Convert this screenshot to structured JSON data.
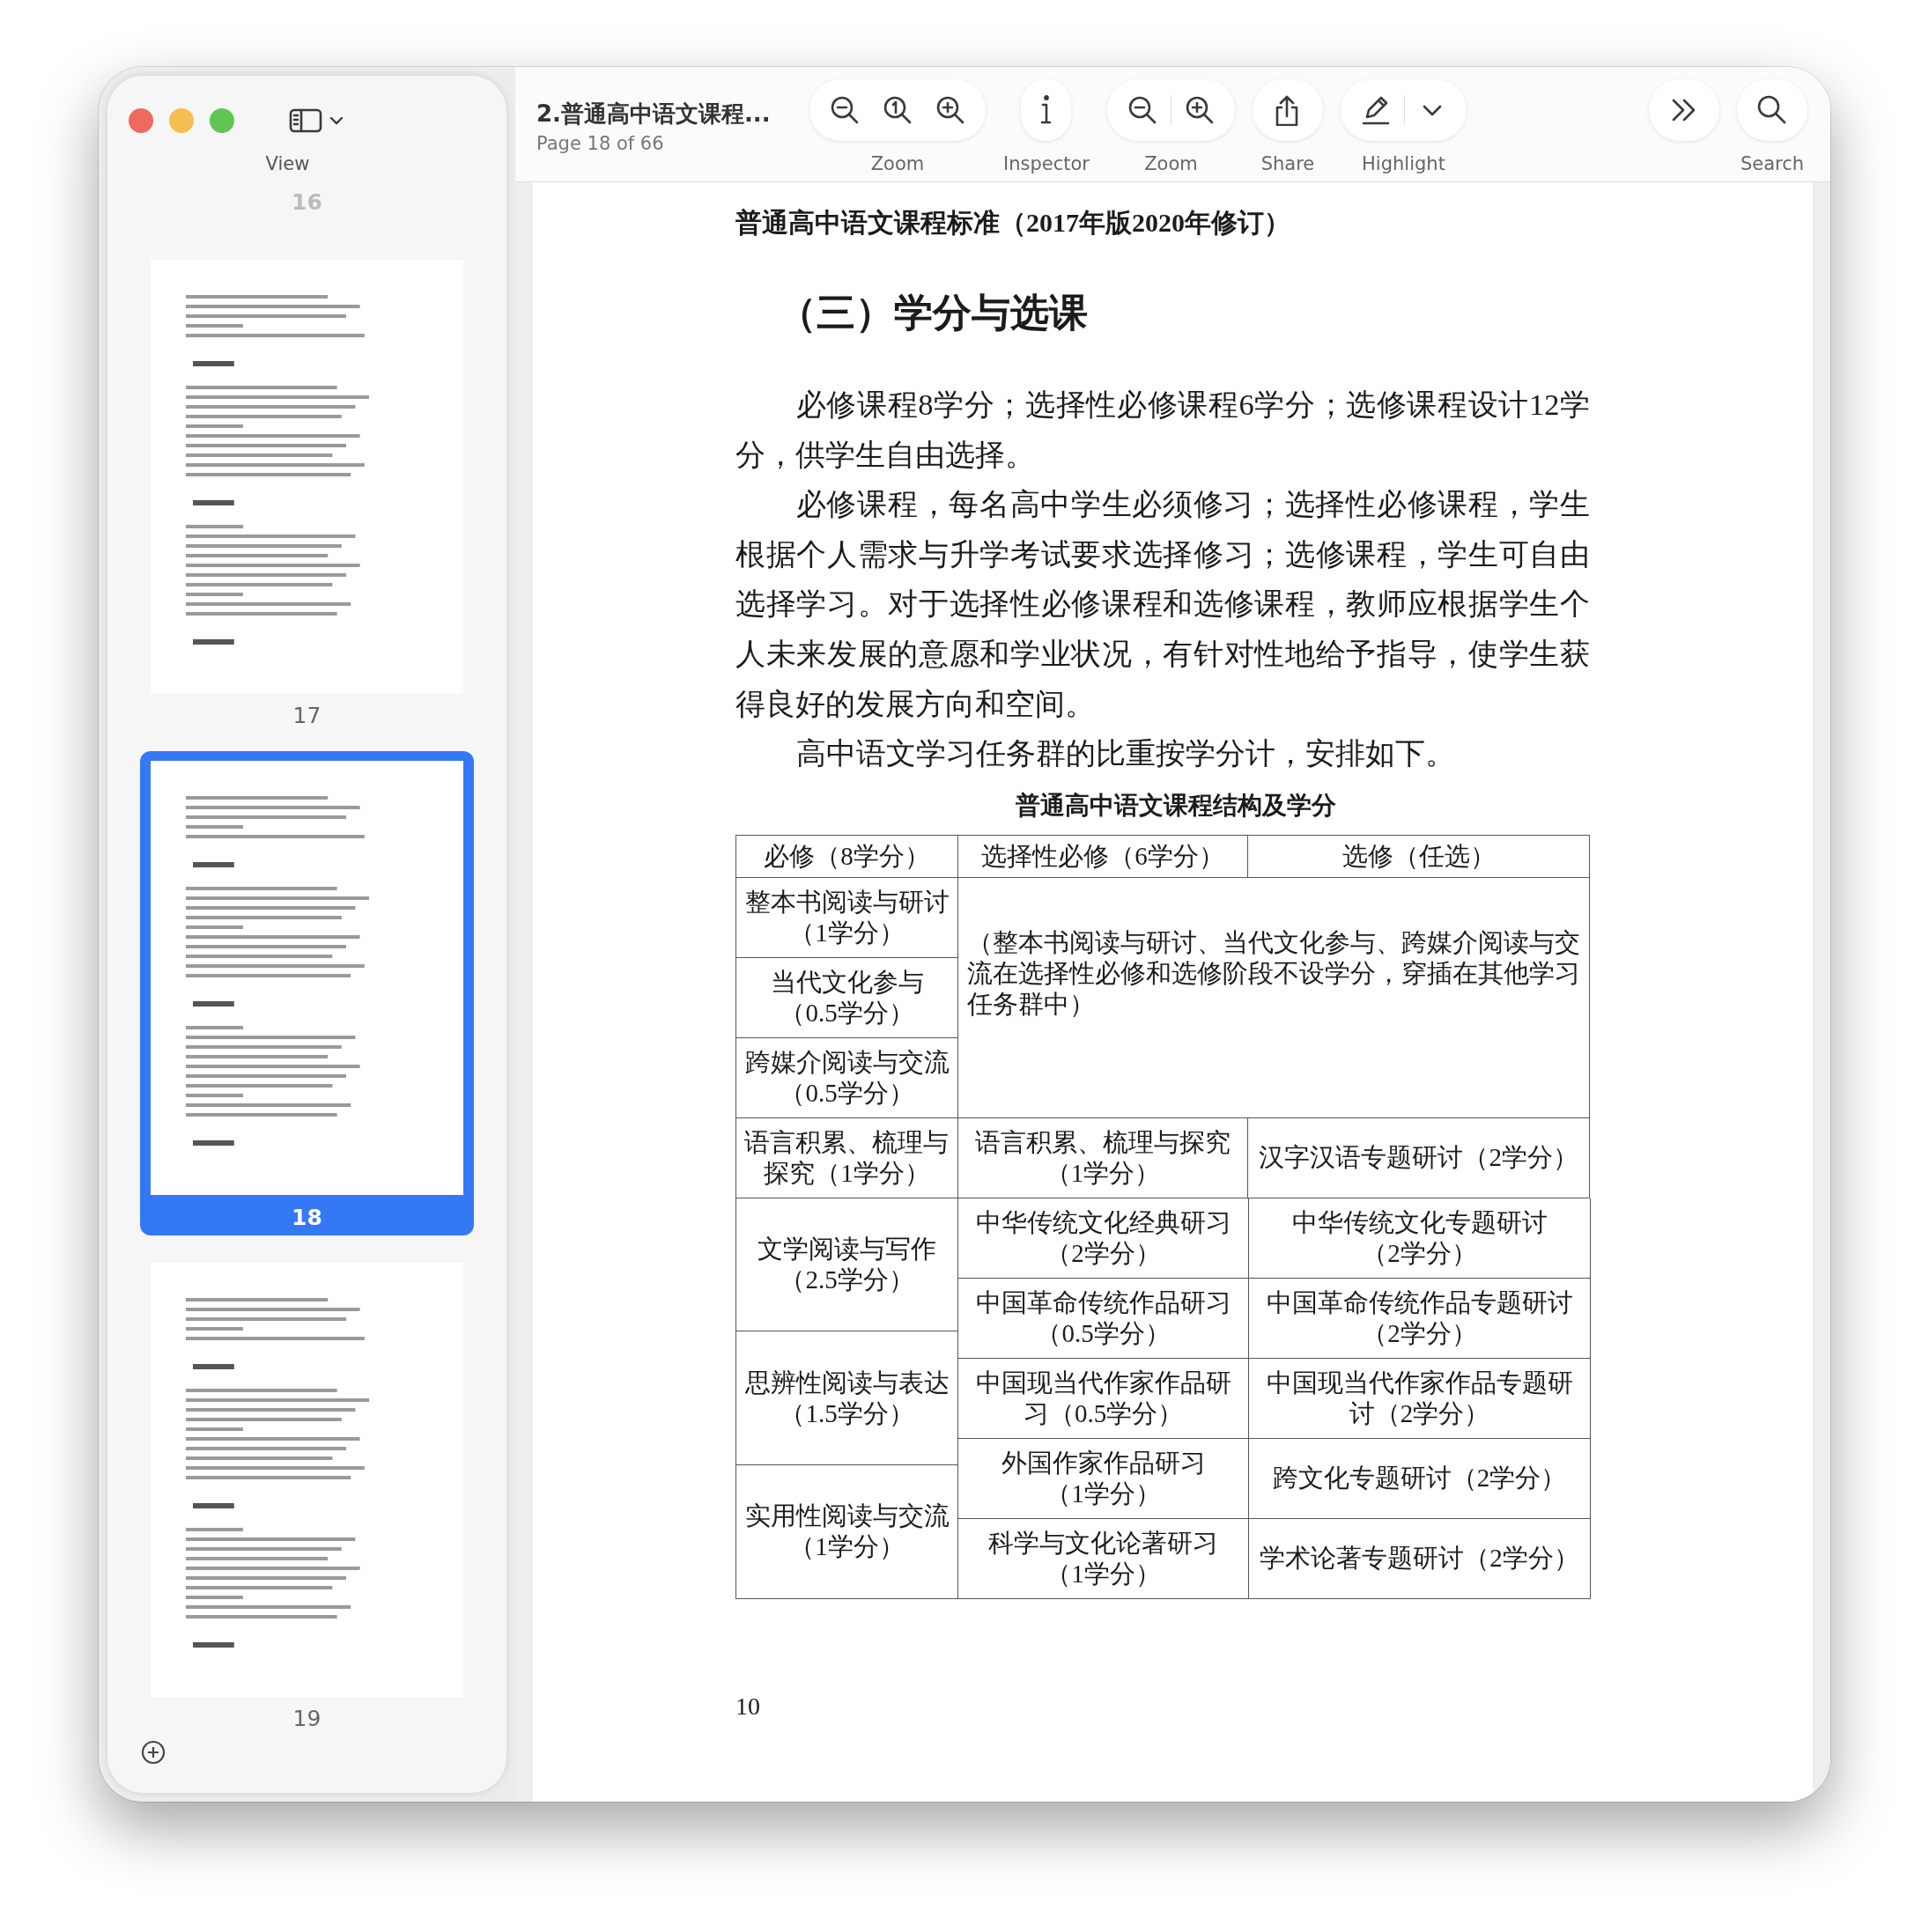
{
  "window": {
    "title": "2.普通高中语文课程...",
    "subtitle": "Page 18 of 66"
  },
  "sidebar": {
    "view_label": "View",
    "pages": [
      {
        "label": "16",
        "selected": false,
        "kind": "partial"
      },
      {
        "label": "17",
        "selected": false,
        "kind": "full"
      },
      {
        "label": "18",
        "selected": true,
        "kind": "full"
      },
      {
        "label": "19",
        "selected": false,
        "kind": "full"
      }
    ]
  },
  "toolbar": [
    {
      "kind": "labeled",
      "label": "Zoom"
    },
    {
      "kind": "labeled",
      "label": "Inspector"
    },
    {
      "kind": "labeled",
      "label": "Zoom"
    },
    {
      "kind": "labeled",
      "label": "Share"
    },
    {
      "kind": "labeled",
      "label": "Highlight"
    },
    {
      "kind": "plain"
    },
    {
      "kind": "labeled",
      "label": "Search"
    }
  ],
  "document": {
    "running_header": "普通高中语文课程标准（2017年版2020年修订）",
    "heading": "（三）学分与选课",
    "paragraphs": [
      "必修课程8学分；选择性必修课程6学分；选修课程设计12学分，供学生自由选择。",
      "必修课程，每名高中学生必须修习；选择性必修课程，学生根据个人需求与升学考试要求选择修习；选修课程，学生可自由选择学习。对于选择性必修课程和选修课程，教师应根据学生个人未来发展的意愿和学业状况，有针对性地给予指导，使学生获得良好的发展方向和空间。",
      "高中语文学习任务群的比重按学分计，安排如下。"
    ],
    "table": {
      "title": "普通高中语文课程结构及学分",
      "columns": [
        "必修（8学分）",
        "选择性必修（6学分）",
        "选修（任选）"
      ],
      "sections": [
        {
          "kind": "merged",
          "left": [
            "整本书阅读与研讨（1学分）",
            "当代文化参与（0.5学分）",
            "跨媒介阅读与交流（0.5学分）"
          ],
          "note": "（整本书阅读与研讨、当代文化参与、跨媒介阅读与交流在选择性必修和选修阶段不设学分，穿插在其他学习任务群中）"
        },
        {
          "kind": "row",
          "cells": [
            "语言积累、梳理与探究（1学分）",
            "语言积累、梳理与探究（1学分）",
            "汉字汉语专题研讨（2学分）"
          ]
        },
        {
          "kind": "split",
          "left": [
            "文学阅读与写作（2.5学分）",
            "思辨性阅读与表达（1.5学分）",
            "实用性阅读与交流（1学分）"
          ],
          "rows": [
            [
              "中华传统文化经典研习（2学分）",
              "中华传统文化专题研讨（2学分）"
            ],
            [
              "中国革命传统作品研习（0.5学分）",
              "中国革命传统作品专题研讨（2学分）"
            ],
            [
              "中国现当代作家作品研习（0.5学分）",
              "中国现当代作家作品专题研讨（2学分）"
            ],
            [
              "外国作家作品研习（1学分）",
              "跨文化专题研讨（2学分）"
            ],
            [
              "科学与文化论著研习（1学分）",
              "学术论著专题研讨（2学分）"
            ]
          ]
        }
      ]
    },
    "page_number": "10"
  }
}
